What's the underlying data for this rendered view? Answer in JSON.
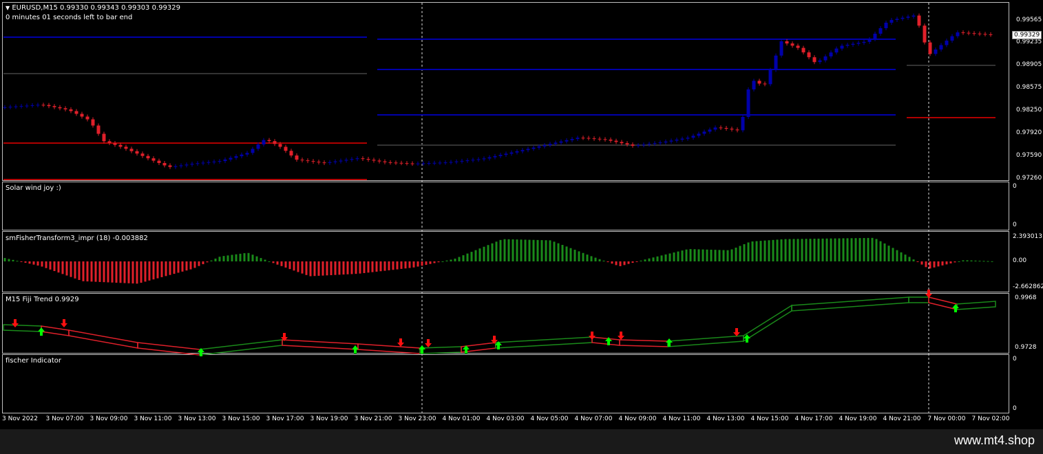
{
  "chart_header": {
    "symbol_line": "EURUSD,M15  0.99330 0.99343 0.99303 0.99329",
    "timer": "0 minutes 01 seconds left to bar end"
  },
  "price_axis": {
    "ticks": [
      "0.99565",
      "0.99235",
      "0.98905",
      "0.98575",
      "0.98250",
      "0.97920",
      "0.97590",
      "0.97260"
    ],
    "current": "0.99329"
  },
  "panes": [
    {
      "title": "Solar wind joy :)",
      "ticks": [
        "0",
        "0"
      ]
    },
    {
      "title": "smFisherTransform3_impr  (18) -0.003882",
      "ticks": [
        "2.393013",
        "0.00",
        "-2.662862"
      ]
    },
    {
      "title": "M15 Fiji Trend 0.9929",
      "ticks": [
        "0.9968",
        "0.9728"
      ]
    },
    {
      "title": "fischer Indicator",
      "ticks": [
        "0",
        "0"
      ]
    }
  ],
  "time_axis": [
    "3 Nov 2022",
    "3 Nov 07:00",
    "3 Nov 09:00",
    "3 Nov 11:00",
    "3 Nov 13:00",
    "3 Nov 15:00",
    "3 Nov 17:00",
    "3 Nov 19:00",
    "3 Nov 21:00",
    "3 Nov 23:00",
    "4 Nov 01:00",
    "4 Nov 03:00",
    "4 Nov 05:00",
    "4 Nov 07:00",
    "4 Nov 09:00",
    "4 Nov 11:00",
    "4 Nov 13:00",
    "4 Nov 15:00",
    "4 Nov 17:00",
    "4 Nov 19:00",
    "4 Nov 21:00",
    "7 Nov 00:00",
    "7 Nov 02:00"
  ],
  "colors": {
    "bull": "#0000aa",
    "bear": "#e0202a",
    "level_blue": "#0000aa",
    "level_red": "#b00000",
    "level_gray": "#333333",
    "hist_pos": "#1a8a1a",
    "hist_neg": "#e0202a",
    "arrow_up": "#00ff00",
    "arrow_down": "#ff1010"
  },
  "footer": {
    "brand": "www.mt4.shop"
  }
}
